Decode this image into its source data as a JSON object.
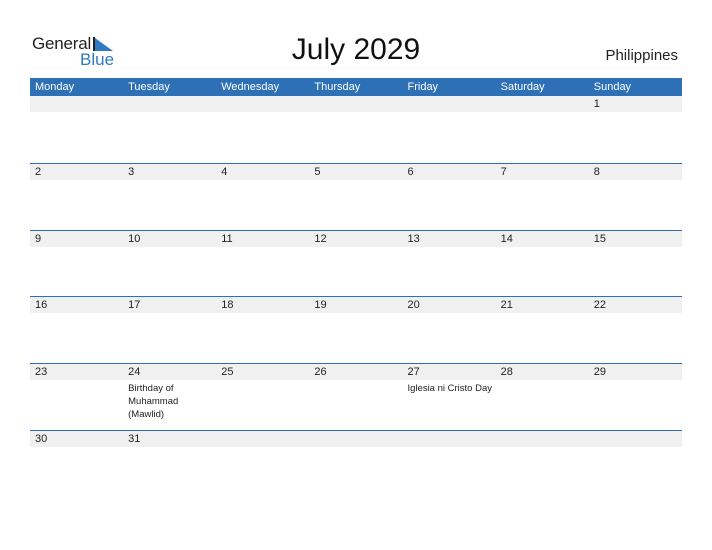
{
  "logo": {
    "word1": "General",
    "word2": "Blue",
    "accent_color": "#2f7ac0"
  },
  "title": "July 2029",
  "country": "Philippines",
  "colors": {
    "header_bg": "#2e70b5",
    "band_bg": "#f0f0f0",
    "rule": "#2e70b5"
  },
  "weekdays": [
    "Monday",
    "Tuesday",
    "Wednesday",
    "Thursday",
    "Friday",
    "Saturday",
    "Sunday"
  ],
  "weeks": [
    {
      "days": [
        {
          "num": "",
          "event": ""
        },
        {
          "num": "",
          "event": ""
        },
        {
          "num": "",
          "event": ""
        },
        {
          "num": "",
          "event": ""
        },
        {
          "num": "",
          "event": ""
        },
        {
          "num": "",
          "event": ""
        },
        {
          "num": "1",
          "event": ""
        }
      ]
    },
    {
      "days": [
        {
          "num": "2",
          "event": ""
        },
        {
          "num": "3",
          "event": ""
        },
        {
          "num": "4",
          "event": ""
        },
        {
          "num": "5",
          "event": ""
        },
        {
          "num": "6",
          "event": ""
        },
        {
          "num": "7",
          "event": ""
        },
        {
          "num": "8",
          "event": ""
        }
      ]
    },
    {
      "days": [
        {
          "num": "9",
          "event": ""
        },
        {
          "num": "10",
          "event": ""
        },
        {
          "num": "11",
          "event": ""
        },
        {
          "num": "12",
          "event": ""
        },
        {
          "num": "13",
          "event": ""
        },
        {
          "num": "14",
          "event": ""
        },
        {
          "num": "15",
          "event": ""
        }
      ]
    },
    {
      "days": [
        {
          "num": "16",
          "event": ""
        },
        {
          "num": "17",
          "event": ""
        },
        {
          "num": "18",
          "event": ""
        },
        {
          "num": "19",
          "event": ""
        },
        {
          "num": "20",
          "event": ""
        },
        {
          "num": "21",
          "event": ""
        },
        {
          "num": "22",
          "event": ""
        }
      ]
    },
    {
      "days": [
        {
          "num": "23",
          "event": ""
        },
        {
          "num": "24",
          "event": "Birthday of Muhammad (Mawlid)"
        },
        {
          "num": "25",
          "event": ""
        },
        {
          "num": "26",
          "event": ""
        },
        {
          "num": "27",
          "event": "Iglesia ni Cristo Day"
        },
        {
          "num": "28",
          "event": ""
        },
        {
          "num": "29",
          "event": ""
        }
      ]
    },
    {
      "days": [
        {
          "num": "30",
          "event": ""
        },
        {
          "num": "31",
          "event": ""
        },
        {
          "num": "",
          "event": ""
        },
        {
          "num": "",
          "event": ""
        },
        {
          "num": "",
          "event": ""
        },
        {
          "num": "",
          "event": ""
        },
        {
          "num": "",
          "event": ""
        }
      ]
    }
  ]
}
